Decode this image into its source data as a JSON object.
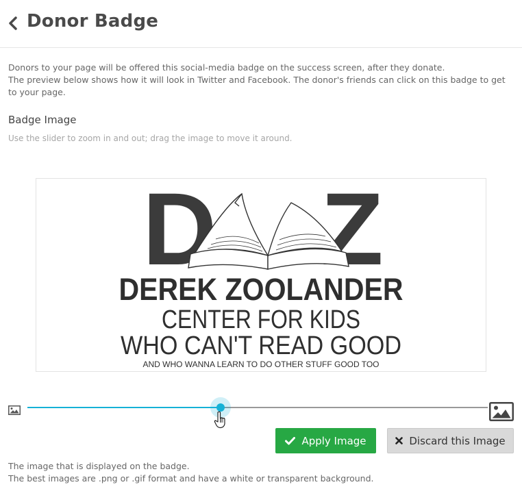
{
  "header": {
    "title": "Donor Badge"
  },
  "description": {
    "line1": "Donors to your page will be offered this social-media badge on the success screen, after they donate.",
    "line2": "The preview below shows how it will look in Twitter and Facebook. The donor's friends can click on this badge to get to your page."
  },
  "badge_section": {
    "title": "Badge Image",
    "hint": "Use the slider to zoom in and out; drag the image to move it around."
  },
  "badge_image": {
    "letter_left": "D",
    "letter_right": "Z",
    "line1": "DEREK ZOOLANDER",
    "line2": "CENTER FOR KIDS",
    "line3": "WHO CAN'T READ GOOD",
    "line4": "AND WHO WANNA LEARN TO DO OTHER STUFF GOOD TOO"
  },
  "zoom_slider": {
    "value": 0.42,
    "accent": "#16b1d6"
  },
  "buttons": {
    "apply_label": "Apply Image",
    "discard_label": "Discard this Image",
    "apply_color": "#27a844"
  },
  "footer": {
    "line1": "The image that is displayed on the badge.",
    "line2": "The best images are .png or .gif format and have a white or transparent background."
  },
  "icons": [
    "chevron-left-icon",
    "image-small-icon",
    "image-large-icon",
    "check-icon",
    "close-icon",
    "hand-cursor-icon"
  ]
}
